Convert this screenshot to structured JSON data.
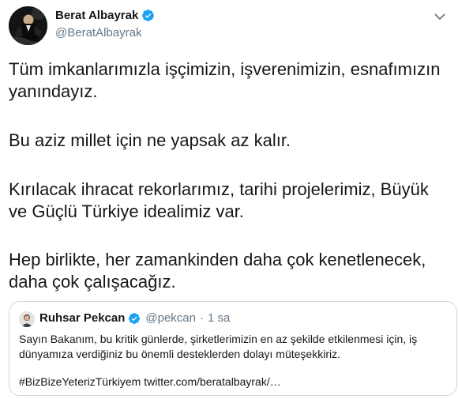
{
  "author": {
    "display_name": "Berat Albayrak",
    "handle": "@BeratAlbayrak",
    "verified_icon": "verified-badge-icon"
  },
  "tweet": {
    "paragraphs": [
      [
        "Tüm imkanlarımızla işçimizin, işverenimizin, esnafımızın",
        "yanındayız."
      ],
      [
        "Bu aziz millet için ne yapsak az kalır."
      ],
      [
        "Kırılacak ihracat rekorlarımız, tarihi projelerimiz, Büyük",
        "ve Güçlü Türkiye idealimiz var."
      ],
      [
        "Hep birlikte, her zamankinden daha çok kenetlenecek,",
        "daha çok çalışacağız."
      ]
    ]
  },
  "quoted": {
    "display_name": "Ruhsar Pekcan",
    "handle": "@pekcan",
    "separator": "·",
    "time": "1 sa",
    "lines": [
      "Sayın Bakanım, bu kritik günlerde, şirketlerimizin en az şekilde etkilenmesi için, iş",
      "dünyamıza verdiğiniz bu önemli desteklerden dolayı müteşekkiriz."
    ],
    "footer": "#BizBizeYeterizTürkiyem twitter.com/beratalbayrak/…"
  },
  "colors": {
    "verified": "#1da1f2",
    "secondary_text": "#657786",
    "border": "#ccd6dd"
  }
}
